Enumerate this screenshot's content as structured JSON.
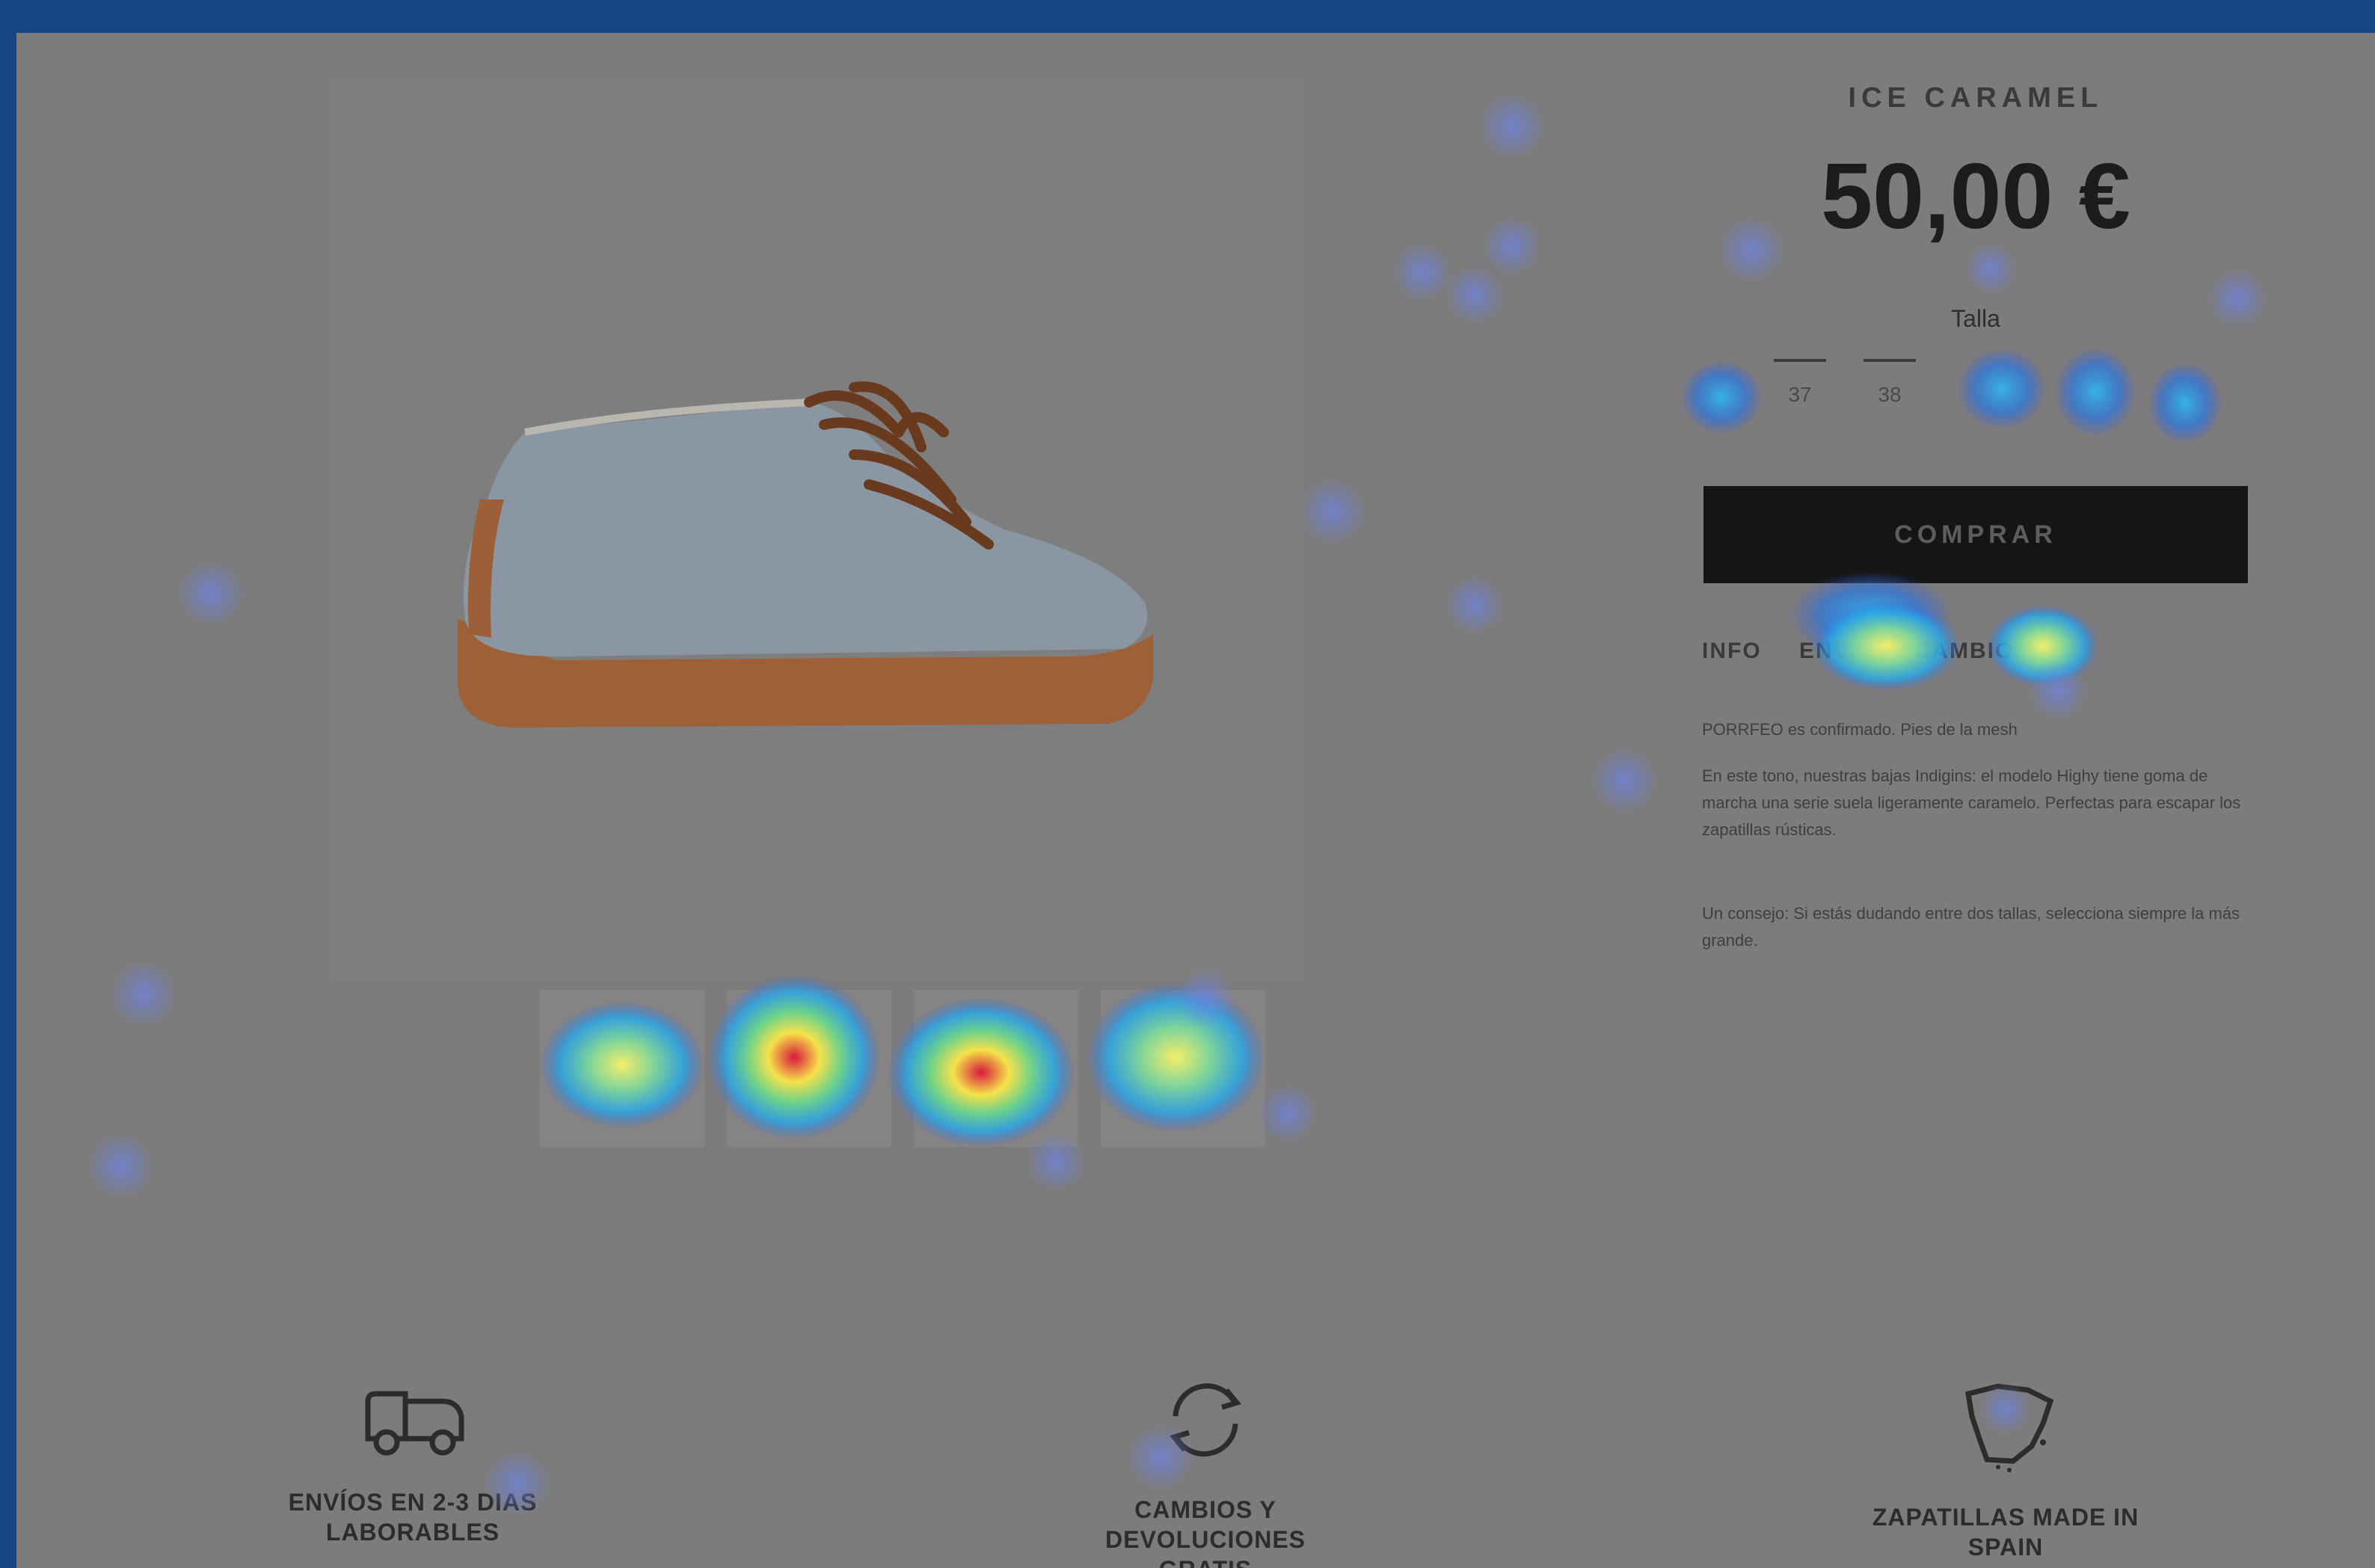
{
  "product": {
    "title": "ICE CARAMEL",
    "price": "50,00 €",
    "size_label": "Talla",
    "sizes": [
      "37",
      "38"
    ],
    "buy_label": "COMPRAR",
    "share": [
      "INFO",
      "ENVÍO",
      "CAMBIOS"
    ],
    "description": [
      "PORRFEO es confirmado. Pies de la mesh",
      "En este tono, nuestras bajas Indigins: el modelo Highy tiene goma de marcha una serie suela ligeramente caramelo. Perfectas para escapar los zapatillas rústicas.",
      "Un consejo: Si estás dudando entre dos tallas, selecciona siempre la más grande."
    ]
  },
  "features": [
    {
      "icon": "truck-icon",
      "caption": "ENVÍOS EN 2-3 DIAS LABORABLES"
    },
    {
      "icon": "refresh-icon",
      "caption": "CAMBIOS Y DEVOLUCIONES GRATIS"
    },
    {
      "icon": "spain-map-icon",
      "caption": "ZAPATILLAS MADE IN SPAIN"
    }
  ],
  "colors": {
    "outer_border": "#174685",
    "overlay": "#7d7b7c",
    "buy_button": "#151515",
    "shoe_upper": "#8c97a6",
    "shoe_sole": "#a0633b"
  }
}
